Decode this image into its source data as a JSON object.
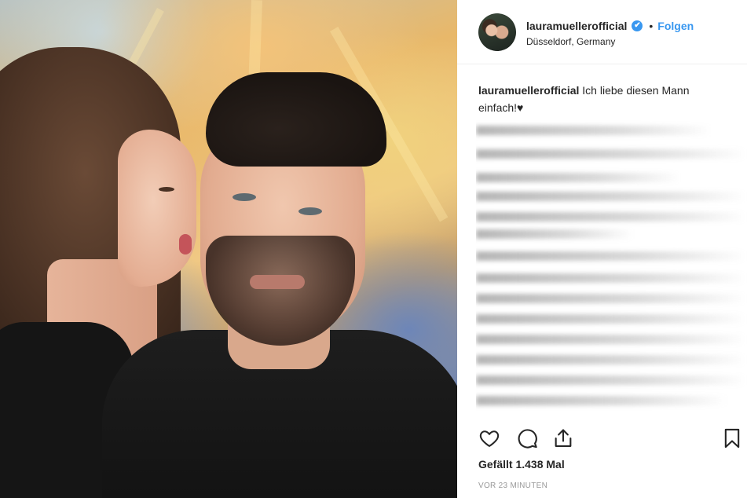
{
  "post": {
    "username": "lauramuellerofficial",
    "verified_badge": "✔",
    "separator": "•",
    "follow_label": "Folgen",
    "location": "Düsseldorf, Germany"
  },
  "caption": {
    "username": "lauramuellerofficial",
    "text": "Ich liebe diesen Mann einfach!♥"
  },
  "actions": {
    "like_icon": "heart-icon",
    "comment_icon": "comment-icon",
    "share_icon": "share-icon",
    "save_icon": "bookmark-icon"
  },
  "likes": "Gefällt 1.438 Mal",
  "timestamp": "VOR 23 MINUTEN",
  "colors": {
    "accent": "#3897f0",
    "text": "#262626",
    "muted": "#999999"
  }
}
